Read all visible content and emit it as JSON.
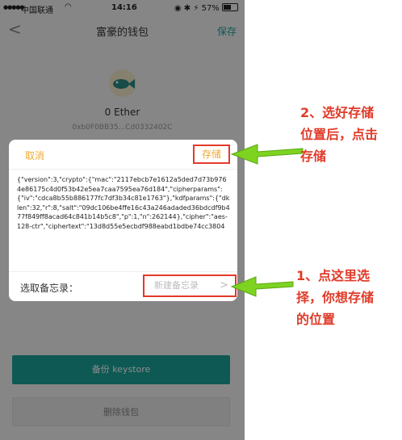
{
  "status_bar": {
    "carrier": "中国联通",
    "wifi_icon": "wifi-icon",
    "time": "14:16",
    "icons": "◉ ✱ ⚡",
    "battery": "57%",
    "battery_level": 0.57
  },
  "nav": {
    "title": "富豪的钱包",
    "save_label": "保存",
    "back_icon": "back-chevron-icon"
  },
  "wallet": {
    "avatar_icon": "fish-icon",
    "balance": "0 Ether",
    "address": "0xb0F0BB35...Cd0332402C"
  },
  "dialog": {
    "cancel_label": "取消",
    "store_label": "存储",
    "keystore_json": "{\"version\":3,\"crypto\":{\"mac\":\"2117ebcb7e1612a5ded7d73b9764e86175c4d0f53b42e5ea7caa7595ea76d184\",\"cipherparams\":{\"iv\":\"cdca8b55b886177fc7df3b34c81e1763\"},\"kdfparams\":{\"dklen\":32,\"r\":8,\"salt\":\"09dc106be4ffe16c43a246adaded36bdcdf9b477f849ff8acad64c841b14b5c8\",\"p\":1,\"n\":262144},\"cipher\":\"aes-128-ctr\",\"ciphertext\":\"13d8d55e5ecbdf988eabd1bdbe74cc3804",
    "select_label": "选取备忘录：",
    "new_memo_label": "新建备忘录",
    "chevron": ">"
  },
  "buttons": {
    "backup_label": "备份 keystore",
    "delete_label": "删除钱包"
  },
  "annotations": {
    "note_store": [
      "2、选好存储",
      "位置后，点击",
      "存储"
    ],
    "note_memo": [
      "1、点这里选",
      "择，你想存储",
      "的位置"
    ]
  },
  "colors": {
    "accent_teal": "#1aa39a",
    "highlight_red": "#e43a2a",
    "arrow_green": "#7ed321",
    "dialog_orange": "#f0a830"
  }
}
